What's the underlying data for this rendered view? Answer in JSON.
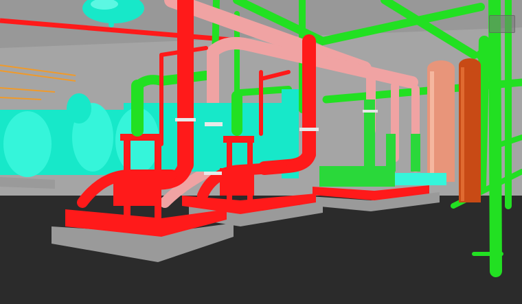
{
  "scene": {
    "type": "3D BIM model viewport - mechanical room",
    "colors": {
      "floor": "#2b2b2b",
      "wall": "#a5a5a5",
      "ceiling_band": "#8f8f8f",
      "supply_pipe": "#ff1a1a",
      "return_pipe": "#f0a3a3",
      "green_pipe": "#22e022",
      "cyan_equipment": "#17e8c9",
      "cyan_light": "#35f5da",
      "orange_duct": "#c84a15",
      "salmon_duct": "#e8957a",
      "concrete_pad": "#9a9a9a",
      "pump_skid_green": "#2ad83a"
    },
    "objects": [
      {
        "name": "expansion-tank",
        "color": "cyan"
      },
      {
        "name": "heat-exchanger-left",
        "color": "cyan"
      },
      {
        "name": "heat-exchanger-right",
        "color": "cyan"
      },
      {
        "name": "pump-skid-1",
        "color": "red"
      },
      {
        "name": "pump-skid-2",
        "color": "red"
      },
      {
        "name": "pump-skid-3",
        "color": "green"
      },
      {
        "name": "vertical-duct-salmon",
        "color": "salmon"
      },
      {
        "name": "vertical-duct-orange",
        "color": "orange"
      },
      {
        "name": "green-column",
        "color": "green"
      }
    ]
  }
}
